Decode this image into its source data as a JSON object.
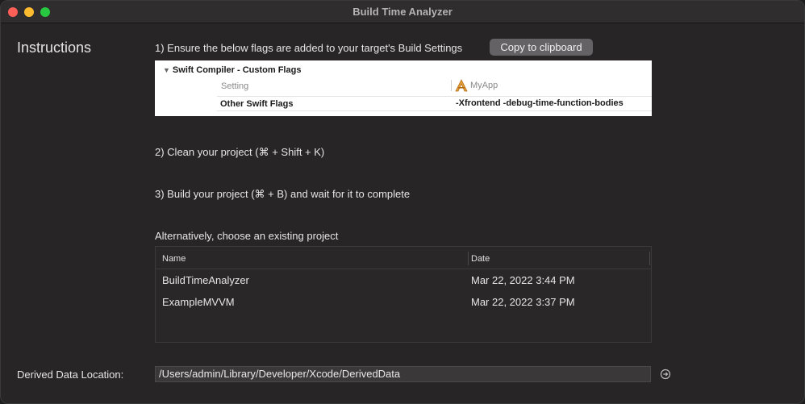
{
  "window": {
    "title": "Build Time Analyzer"
  },
  "instructions": {
    "heading": "Instructions",
    "step1": "1) Ensure the below flags are added to your target's Build Settings",
    "copy_button": "Copy to clipboard",
    "build_settings": {
      "section": "Swift Compiler - Custom Flags",
      "setting_column": "Setting",
      "app_column": "MyApp",
      "row_name": "Other Swift Flags",
      "row_value": "-Xfrontend -debug-time-function-bodies"
    },
    "step2": "2) Clean your project (⌘ + Shift + K)",
    "step3": "3) Build your project (⌘ + B) and wait for it to complete",
    "alternative": "Alternatively, choose an existing project"
  },
  "projects": {
    "columns": [
      "Name",
      "Date"
    ],
    "rows": [
      {
        "name": "BuildTimeAnalyzer",
        "date": "Mar 22, 2022 3:44 PM"
      },
      {
        "name": "ExampleMVVM",
        "date": "Mar 22, 2022 3:37 PM"
      }
    ]
  },
  "derived_data": {
    "label": "Derived Data Location:",
    "path": "/Users/admin/Library/Developer/Xcode/DerivedData"
  },
  "icons": {
    "close": "close-icon",
    "minimize": "minimize-icon",
    "maximize": "maximize-icon",
    "disclosure": "disclosure-triangle-icon",
    "app": "xcode-app-icon",
    "go": "arrow-circle-right-icon"
  },
  "colors": {
    "window_bg": "#282527",
    "close": "#fe5f57",
    "minimize": "#febc2e",
    "maximize": "#28c840",
    "button": "#646264"
  }
}
